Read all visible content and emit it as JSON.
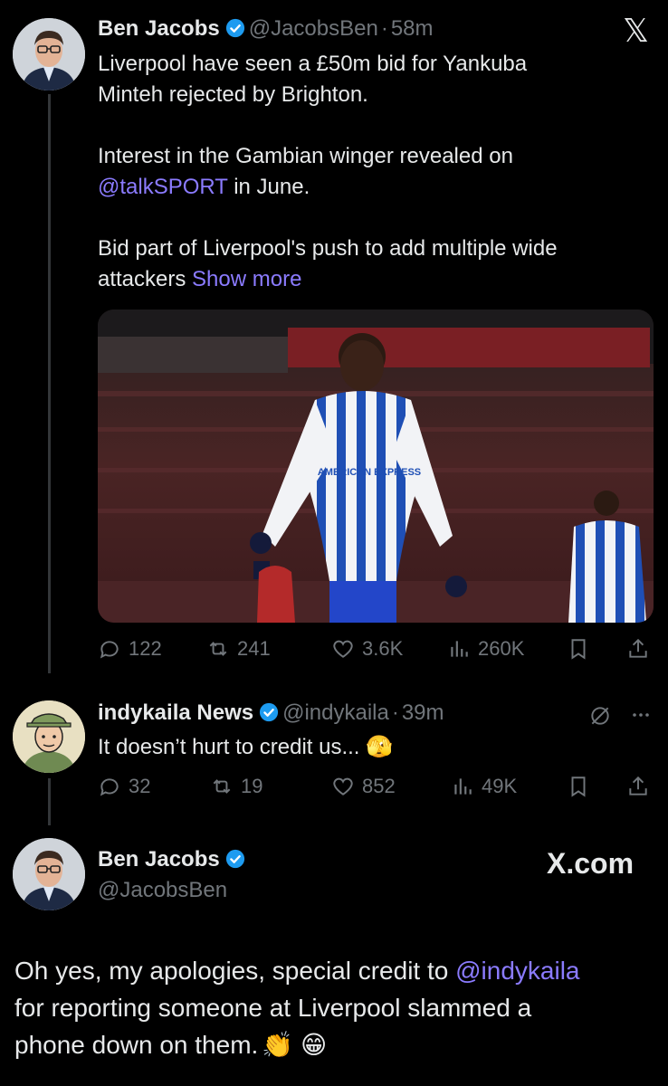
{
  "x_logo_glyph": "𝕏",
  "tweet1": {
    "name": "Ben Jacobs",
    "handle": "@JacobsBen",
    "dot": "·",
    "time": "58m",
    "line1": "Liverpool have seen a £50m bid for Yankuba",
    "line2": "Minteh rejected by Brighton.",
    "line3": "Interest in the Gambian winger revealed on",
    "line4_link": "@talkSPORT",
    "line4_rest": " in June.",
    "line5": "Bid part of Liverpool's push to add multiple wide",
    "line6": "attackers ",
    "show_more": "Show more",
    "image": {
      "jersey_sponsor": "AMERICAN EXPRESS",
      "colors": {
        "stripe_blue": "#1f4fb5",
        "shorts": "#2346c9",
        "crowd": "#3a1d1e"
      }
    },
    "stats": {
      "replies": "122",
      "reposts": "241",
      "likes": "3.6K",
      "views": "260K"
    }
  },
  "tweet2": {
    "name": "indykaila News",
    "handle": "@indykaila",
    "dot": "·",
    "time": "39m",
    "text": "It doesn’t hurt to credit us... ",
    "emoji": "🫣",
    "stats": {
      "replies": "32",
      "reposts": "19",
      "likes": "852",
      "views": "49K"
    }
  },
  "tweet3": {
    "name": "Ben Jacobs",
    "handle": "@JacobsBen",
    "brand": "X.com",
    "line1_pre": "Oh yes, my apologies, special credit to ",
    "line1_link": "@indykaila",
    "line2": "for reporting someone at Liverpool slammed a",
    "line3": "phone down on them.",
    "emoji1": "👏",
    "emoji2": "😁"
  },
  "colors": {
    "background": "#000000",
    "text": "#e7e9ea",
    "muted": "#71767b",
    "link": "#8b7bff",
    "verified": "#1d9bf0"
  }
}
